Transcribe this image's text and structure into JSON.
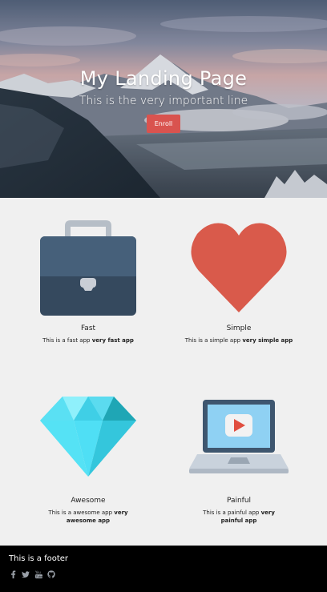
{
  "hero": {
    "title": "My Landing Page",
    "subtitle": "This is the very important line",
    "button_label": "Enroll",
    "button_color": "#d9534f"
  },
  "features": [
    {
      "icon": "briefcase-icon",
      "title": "Fast",
      "desc_prefix": "This is a fast app ",
      "desc_bold": "very fast app"
    },
    {
      "icon": "heart-icon",
      "title": "Simple",
      "desc_prefix": "This is a simple app ",
      "desc_bold": "very simple app"
    },
    {
      "icon": "diamond-icon",
      "title": "Awesome",
      "desc_prefix": "This is a awesome app ",
      "desc_bold": "very awesome app"
    },
    {
      "icon": "laptop-play-icon",
      "title": "Painful",
      "desc_prefix": "This is a painful app ",
      "desc_bold": "very painful app"
    }
  ],
  "footer": {
    "text": "This is a footer",
    "social_icons": [
      "facebook-icon",
      "twitter-icon",
      "youtube-icon",
      "github-icon"
    ]
  },
  "colors": {
    "page_bg": "#f0f0f0",
    "footer_bg": "#000000",
    "briefcase_body": "#3e566f",
    "heart": "#d95a4b",
    "diamond": "#4fdff5",
    "laptop_frame": "#3e566f",
    "laptop_screen": "#8fd1f3"
  }
}
